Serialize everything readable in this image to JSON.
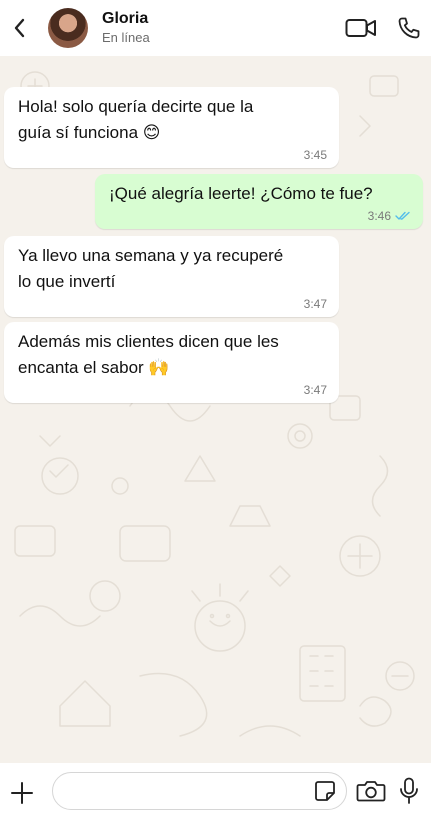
{
  "header": {
    "name": "Gloria",
    "status": "En línea"
  },
  "messages": [
    {
      "direction": "in",
      "lines": [
        "Hola! solo quería decirte que la",
        "guía sí funciona 😊"
      ],
      "time": "3:45"
    },
    {
      "direction": "out",
      "lines": [
        "¡Qué alegría leerte! ¿Cómo te fue?"
      ],
      "time": "3:46",
      "read": true
    },
    {
      "direction": "in",
      "lines": [
        "Ya llevo una semana y ya recuperé",
        "lo que invertí"
      ],
      "time": "3:47"
    },
    {
      "direction": "in",
      "lines": [
        "Además mis clientes dicen que les",
        "encanta el sabor 🙌"
      ],
      "time": "3:47"
    }
  ],
  "composer": {
    "placeholder": ""
  },
  "colors": {
    "chat_background": "#f5f1eb",
    "outgoing_bubble": "#d8fdd2",
    "incoming_bubble": "#ffffff",
    "read_tick": "#53bdeb"
  },
  "icons": [
    "back-arrow-icon",
    "video-call-icon",
    "phone-icon",
    "plus-icon",
    "sticker-icon",
    "camera-icon",
    "microphone-icon"
  ]
}
